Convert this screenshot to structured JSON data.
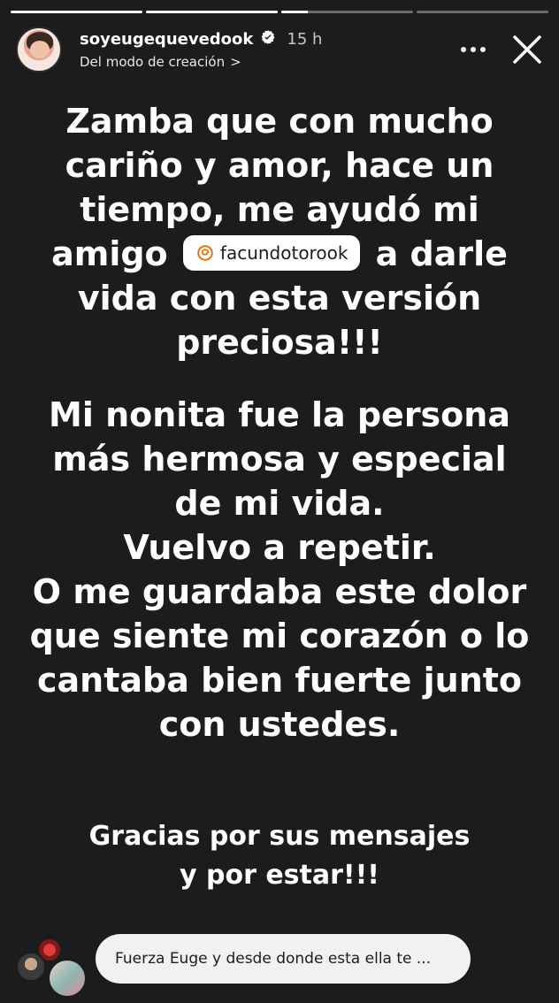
{
  "progress": {
    "segments": [
      1,
      1,
      0.2,
      0
    ]
  },
  "header": {
    "username": "soyeugequevedook",
    "time": "15 h",
    "subtitle": "Del modo de creación",
    "chevron": ">"
  },
  "story": {
    "line1": "Zamba que con mucho",
    "line2": "cariño y amor, hace un",
    "line3": "tiempo, me ayudó mi",
    "line4_before": "amigo",
    "mention": "facundotorook",
    "line4_after": "a darle",
    "line5": "vida con esta versión",
    "line6": "preciosa!!!",
    "p2_line1": "Mi nonita fue la persona",
    "p2_line2": "más hermosa y especial",
    "p2_line3": "de mi vida.",
    "p2_line4": "Vuelvo a repetir.",
    "p2_line5": "O me guardaba este dolor",
    "p2_line6": "que siente mi corazón o lo",
    "p2_line7": "cantaba bien fuerte junto",
    "p2_line8": "con ustedes.",
    "thanks_line1": "Gracias por sus mensajes",
    "thanks_line2": "y por estar!!!"
  },
  "reply": {
    "text": "Fuerza Euge y desde donde esta ella te ..."
  },
  "colors": {
    "background": "#1c1c1c",
    "text": "#ffffff",
    "verified": "#ffffff",
    "mention_bg": "#ffffff",
    "reply_bg": "#f1f1f1"
  },
  "icons": [
    "verified-badge-icon",
    "more-options-icon",
    "close-icon",
    "threads-logo-icon"
  ]
}
